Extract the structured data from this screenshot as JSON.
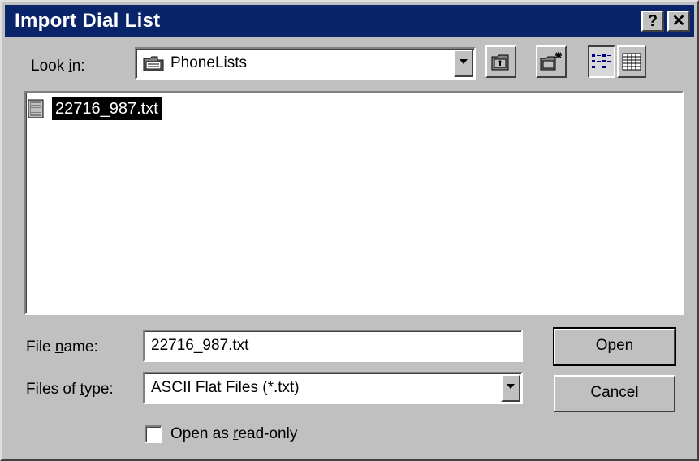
{
  "window": {
    "title": "Import Dial List",
    "help_label": "?",
    "close_label": "✕"
  },
  "look_in": {
    "label_pre": "Look ",
    "label_key": "i",
    "label_post": "n:",
    "value": "PhoneLists",
    "icon": "folder-icon"
  },
  "toolbar": {
    "up_icon": "up-one-level-icon",
    "new_folder_icon": "new-folder-icon",
    "list_icon": "list-view-icon",
    "details_icon": "details-view-icon"
  },
  "files": [
    {
      "name": "22716_987.txt",
      "icon": "text-file-icon",
      "selected": true
    }
  ],
  "file_name": {
    "label_pre": "File ",
    "label_key": "n",
    "label_post": "ame:",
    "value": "22716_987.txt"
  },
  "file_type": {
    "label_pre": "Files of ",
    "label_key": "t",
    "label_post": "ype:",
    "value": "ASCII Flat Files (*.txt)"
  },
  "buttons": {
    "open_key": "O",
    "open_rest": "pen",
    "cancel": "Cancel"
  },
  "readonly": {
    "label_pre": "Open as ",
    "label_key": "r",
    "label_post": "ead-only",
    "checked": false
  }
}
